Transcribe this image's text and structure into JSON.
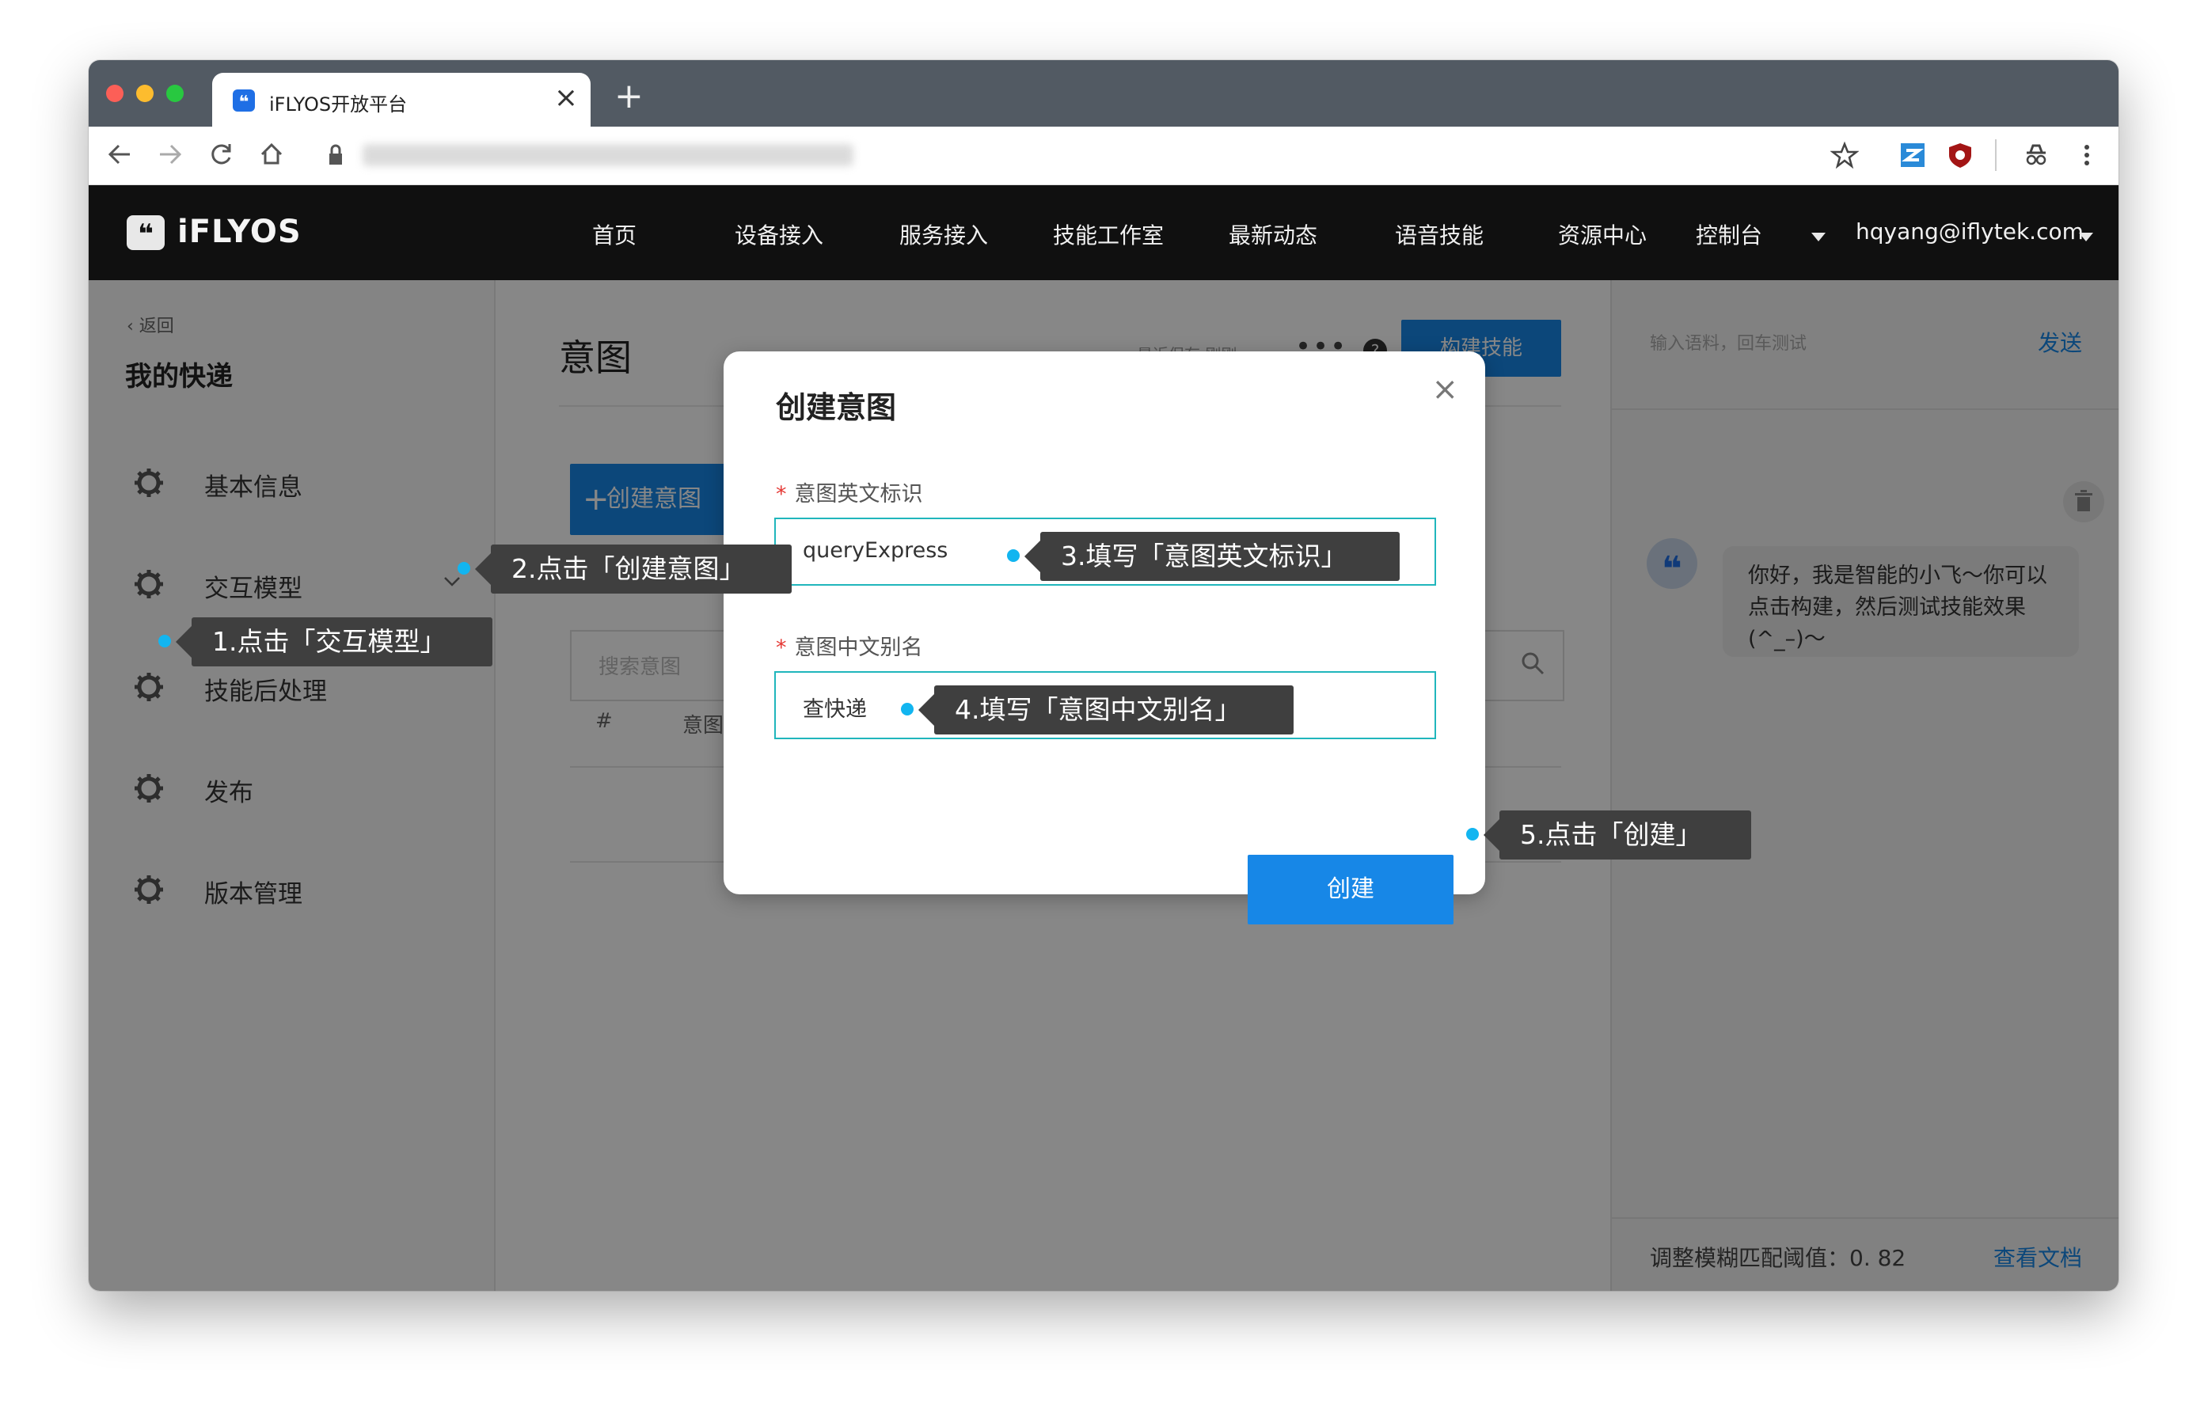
{
  "browser": {
    "tab_title": "iFLYOS开放平台",
    "tab_close": "×",
    "new_tab": "+",
    "icons": [
      "back-arrow-icon",
      "forward-arrow-icon",
      "reload-icon",
      "home-icon",
      "lock-icon",
      "star-icon",
      "extension-icon",
      "shield-extension-icon",
      "incognito-icon",
      "more-vert-icon"
    ]
  },
  "header": {
    "logo_text": "iFLYOS",
    "logo_glyph": "❝",
    "menu": [
      "首页",
      "设备接入",
      "服务接入",
      "技能工作室",
      "最新动态",
      "语音技能",
      "资源中心",
      "控制台"
    ],
    "user_email": "hqyang@iflytek.com"
  },
  "sidebar": {
    "back_label": "返回",
    "project_title": "我的快递",
    "items": [
      {
        "label": "基本信息"
      },
      {
        "label": "交互模型"
      },
      {
        "label": "技能后处理"
      },
      {
        "label": "发布"
      },
      {
        "label": "版本管理"
      }
    ]
  },
  "content": {
    "title": "意图",
    "save_status": "最近保存 刚刚",
    "more": "•••",
    "help": "?",
    "build_button": "构建技能",
    "create_button": "创建意图",
    "create_plus": "+",
    "search_placeholder": "搜索意图",
    "table_headers": [
      "#",
      "意图名称"
    ]
  },
  "right_panel": {
    "input_placeholder": "输入语料，回车测试",
    "send_label": "发送",
    "avatar_glyph": "❝",
    "bot_message": "你好，我是智能的小飞～你可以点击构建，然后测试技能效果(^_–)～",
    "threshold_label": "调整模糊匹配阈值：0. 82",
    "doc_link": "查看文档"
  },
  "modal": {
    "title": "创建意图",
    "close": "×",
    "required_mark": "*",
    "field1_label": "意图英文标识",
    "field1_value": "queryExpress",
    "field2_label": "意图中文别名",
    "field2_value": "查快递",
    "create_button": "创建"
  },
  "annotations": {
    "step1": "1.点击「交互模型」",
    "step2": "2.点击「创建意图」",
    "step3": "3.填写「意图英文标识」",
    "step4": "4.填写「意图中文别名」",
    "step5": "5.点击「创建」"
  },
  "colors": {
    "accent": "#1787e7",
    "header_bg": "#101010",
    "callout_bg": "#3f3f3f",
    "callout_dot": "#12b5f0",
    "input_border": "#20b6bc"
  }
}
